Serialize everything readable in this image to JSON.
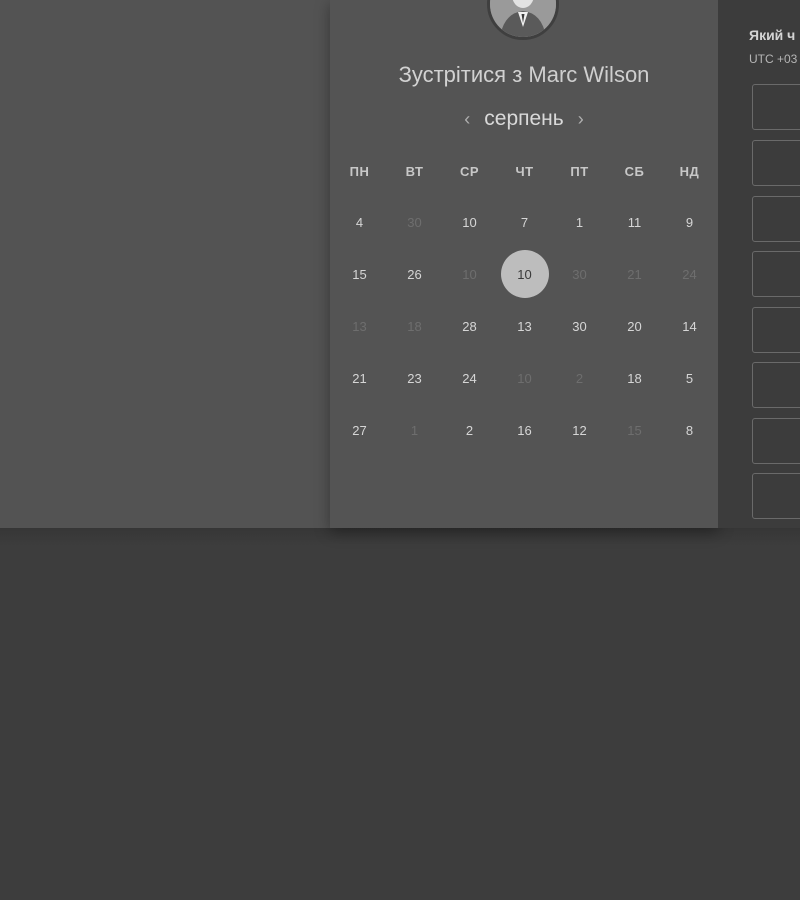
{
  "meeting": {
    "prefix": "Зустрітися з",
    "host_name": "Marc Wilson",
    "avatar_icon": "person-portrait"
  },
  "calendar": {
    "month": "серпень",
    "prev_icon": "chevron-left-icon",
    "next_icon": "chevron-right-icon",
    "weekdays": [
      "ПН",
      "ВТ",
      "СР",
      "ЧТ",
      "ПТ",
      "СБ",
      "НД"
    ],
    "days": [
      {
        "label": "4",
        "muted": false
      },
      {
        "label": "30",
        "muted": true
      },
      {
        "label": "10",
        "muted": false
      },
      {
        "label": "7",
        "muted": false
      },
      {
        "label": "1",
        "muted": false
      },
      {
        "label": "11",
        "muted": false
      },
      {
        "label": "9",
        "muted": false
      },
      {
        "label": "15",
        "muted": false
      },
      {
        "label": "26",
        "muted": false
      },
      {
        "label": "10",
        "muted": true
      },
      {
        "label": "10",
        "muted": false,
        "selected": true
      },
      {
        "label": "30",
        "muted": true
      },
      {
        "label": "21",
        "muted": true
      },
      {
        "label": "24",
        "muted": true
      },
      {
        "label": "13",
        "muted": true
      },
      {
        "label": "18",
        "muted": true
      },
      {
        "label": "28",
        "muted": false
      },
      {
        "label": "13",
        "muted": false
      },
      {
        "label": "30",
        "muted": false
      },
      {
        "label": "20",
        "muted": false
      },
      {
        "label": "14",
        "muted": false
      },
      {
        "label": "21",
        "muted": false
      },
      {
        "label": "23",
        "muted": false
      },
      {
        "label": "24",
        "muted": false
      },
      {
        "label": "10",
        "muted": true
      },
      {
        "label": "2",
        "muted": true
      },
      {
        "label": "18",
        "muted": false
      },
      {
        "label": "5",
        "muted": false
      },
      {
        "label": "27",
        "muted": false
      },
      {
        "label": "1",
        "muted": true
      },
      {
        "label": "2",
        "muted": false
      },
      {
        "label": "16",
        "muted": false
      },
      {
        "label": "12",
        "muted": false
      },
      {
        "label": "15",
        "muted": true
      },
      {
        "label": "8",
        "muted": false
      }
    ]
  },
  "timezone": {
    "question": "Який ч",
    "value": "UTC +03"
  },
  "time_slots": [
    "",
    "",
    "",
    "",
    "",
    "",
    "",
    ""
  ],
  "colors": {
    "background": "#3d3d3d",
    "card": "#545454",
    "selected_day": "#bdbdbd",
    "muted_day": "#6e6e6e"
  }
}
